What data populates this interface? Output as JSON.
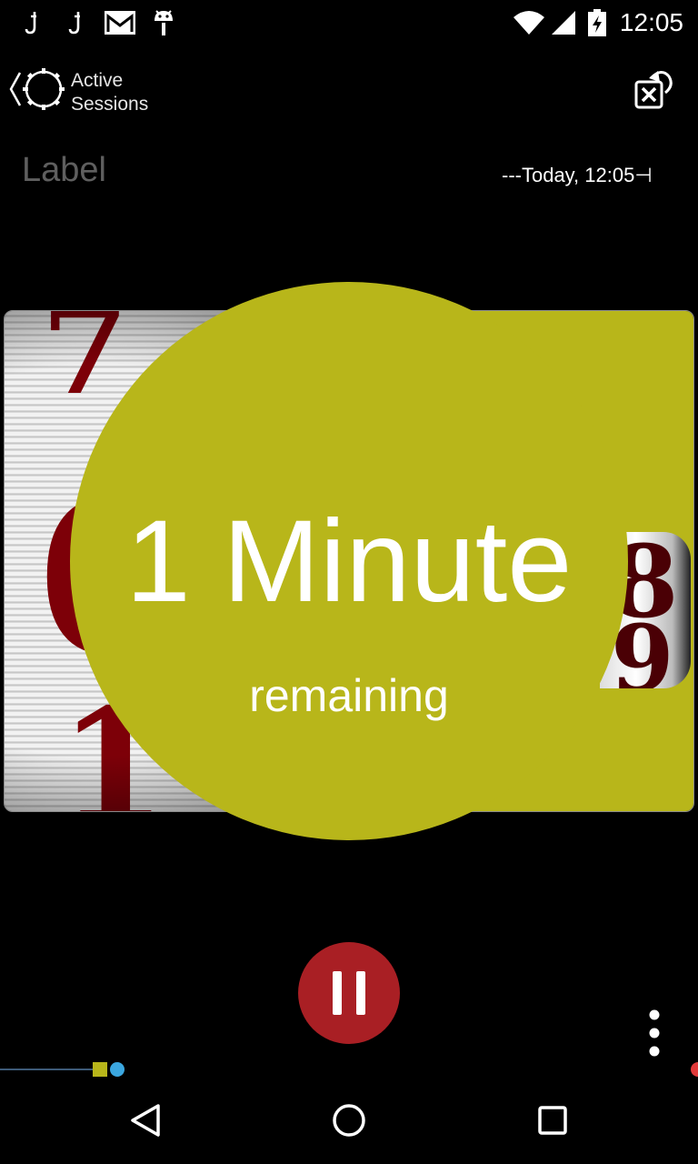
{
  "status_bar": {
    "time": "12:05",
    "icons": [
      "usb-debug-icon",
      "usb-debug-icon",
      "gmail-icon",
      "android-icon",
      "wifi-icon",
      "cell-signal-icon",
      "battery-charging-icon"
    ]
  },
  "header": {
    "back_icon": "back-gear-icon",
    "title_line1": "Active",
    "title_line2": "Sessions",
    "close_icon": "close-session-icon"
  },
  "session": {
    "label": "Label",
    "time_text": "---Today, 12:05⊣"
  },
  "countdown": {
    "value": "1 Minute",
    "label": "remaining",
    "color": "#b8b61a"
  },
  "controls": {
    "pause_icon": "pause-icon",
    "pause_color": "#a91f24",
    "overflow_icon": "more-vert-icon"
  },
  "progress": {
    "square_color": "#b8b61a",
    "dot_color": "#3ba7e0",
    "end_color": "#e03a3a"
  },
  "nav": {
    "back_icon": "nav-back-icon",
    "home_icon": "nav-home-icon",
    "recents_icon": "nav-recents-icon"
  }
}
